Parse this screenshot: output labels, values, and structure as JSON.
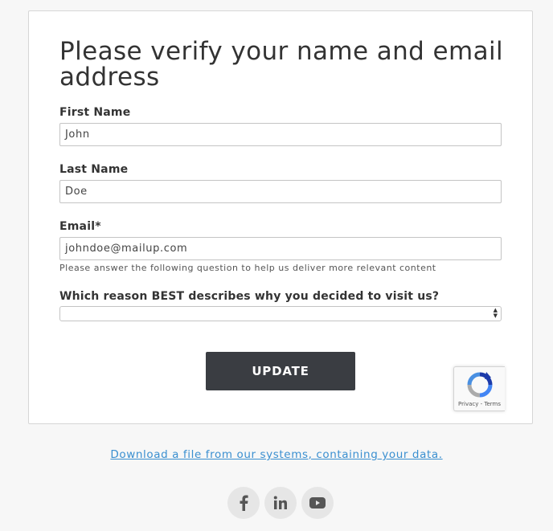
{
  "form": {
    "title": "Please verify your name and email address",
    "first_name": {
      "label": "First Name",
      "value": "John"
    },
    "last_name": {
      "label": "Last Name",
      "value": "Doe"
    },
    "email": {
      "label": "Email*",
      "value": "johndoe@mailup.com"
    },
    "help_text": "Please answer the following question to help us deliver more relevant content",
    "reason": {
      "label": "Which reason BEST describes why you decided to visit us?",
      "value": ""
    },
    "submit_label": "UPDATE"
  },
  "recaptcha": {
    "terms": "Privacy - Terms"
  },
  "footer": {
    "download_link": "Download a file from our systems, containing your data.",
    "social": [
      {
        "name": "facebook-icon",
        "glyph": "f"
      },
      {
        "name": "linkedin-icon",
        "glyph": "in"
      },
      {
        "name": "youtube-icon",
        "glyph": "▶"
      }
    ]
  },
  "colors": {
    "button_bg": "#3a3d42",
    "link": "#3a8fd0",
    "page_bg": "#f7f7f7",
    "social_bg": "#e6e6e6"
  }
}
